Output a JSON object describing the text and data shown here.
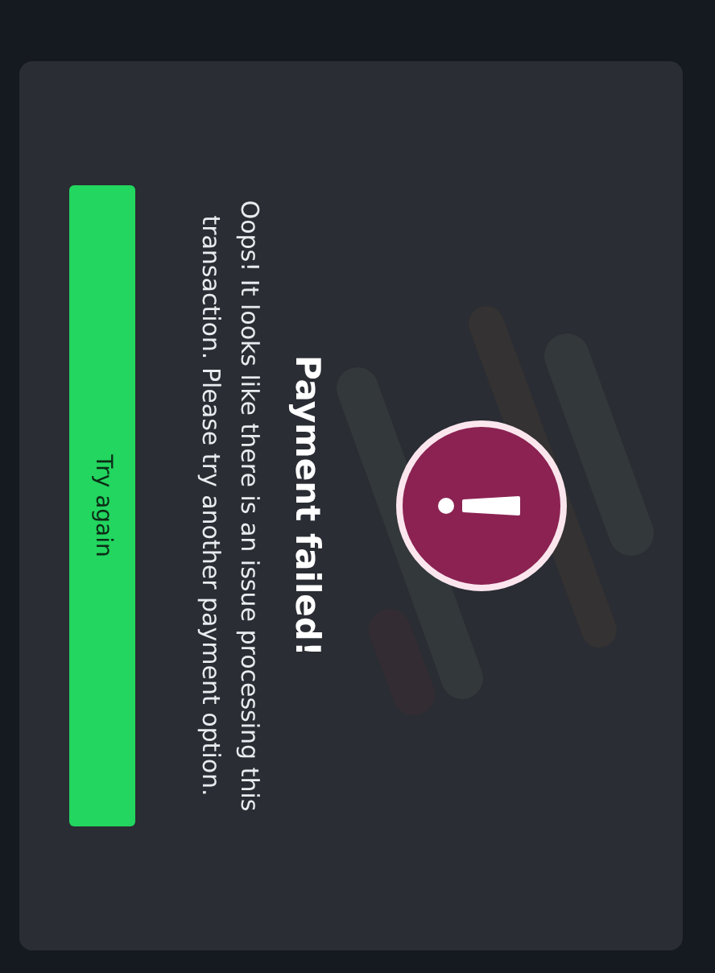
{
  "dialog": {
    "title": "Payment failed!",
    "message": "Oops! It looks like there is an issue processing this transaction. Please try another payment option.",
    "button": "Try again"
  }
}
